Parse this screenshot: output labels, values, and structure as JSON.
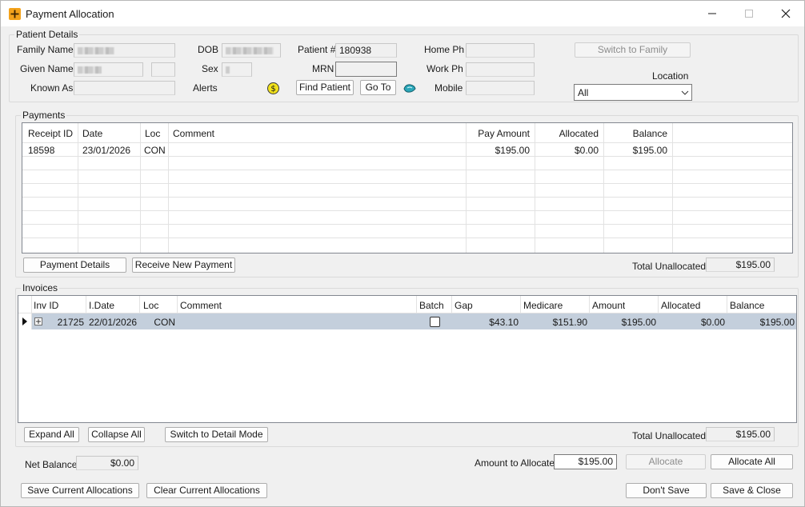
{
  "window": {
    "title": "Payment Allocation"
  },
  "patient": {
    "group_title": "Patient Details",
    "family_name_label": "Family Name",
    "given_name_label": "Given Name",
    "known_as_label": "Known As",
    "dob_label": "DOB",
    "sex_label": "Sex",
    "alerts_label": "Alerts",
    "patient_no_label": "Patient #",
    "patient_no": "180938",
    "mrn_label": "MRN",
    "mrn": "",
    "home_ph_label": "Home Ph",
    "work_ph_label": "Work Ph",
    "mobile_label": "Mobile",
    "find_patient": "Find Patient",
    "go_to": "Go To",
    "switch_family": "Switch to Family",
    "location_label": "Location",
    "location_value": "All"
  },
  "payments": {
    "group_title": "Payments",
    "columns": [
      "Receipt ID",
      "Date",
      "Loc",
      "Comment",
      "Pay Amount",
      "Allocated",
      "Balance"
    ],
    "rows": [
      {
        "receipt_id": "18598",
        "date": "23/01/2026",
        "loc": "CON",
        "comment": "",
        "pay_amount": "$195.00",
        "allocated": "$0.00",
        "balance": "$195.00"
      }
    ],
    "payment_details": "Payment Details",
    "receive_new_payment": "Receive New Payment",
    "total_unallocated_label": "Total Unallocated",
    "total_unallocated": "$195.00"
  },
  "invoices": {
    "group_title": "Invoices",
    "columns": [
      "Inv ID",
      "I.Date",
      "Loc",
      "Comment",
      "Batch",
      "Gap",
      "Medicare",
      "Amount",
      "Allocated",
      "Balance"
    ],
    "rows": [
      {
        "inv_id": "21725",
        "date": "22/01/2026",
        "loc": "CON",
        "comment": "",
        "batch": false,
        "gap": "$43.10",
        "medicare": "$151.90",
        "amount": "$195.00",
        "allocated": "$0.00",
        "balance": "$195.00"
      }
    ],
    "expand_all": "Expand All",
    "collapse_all": "Collapse All",
    "switch_detail": "Switch to Detail Mode",
    "total_unallocated_label": "Total Unallocated",
    "total_unallocated": "$195.00"
  },
  "footer": {
    "net_balance_label": "Net Balance",
    "net_balance": "$0.00",
    "amount_to_allocate_label": "Amount to Allocate",
    "amount_to_allocate": "$195.00",
    "allocate": "Allocate",
    "allocate_all": "Allocate All",
    "save_current": "Save Current Allocations",
    "clear_current": "Clear Current Allocations",
    "dont_save": "Don't Save",
    "save_close": "Save & Close"
  },
  "colors": {
    "selected_row": "#c4cfdc",
    "dollar_badge": "#f2e21b",
    "app_icon": "#f3a21b"
  }
}
